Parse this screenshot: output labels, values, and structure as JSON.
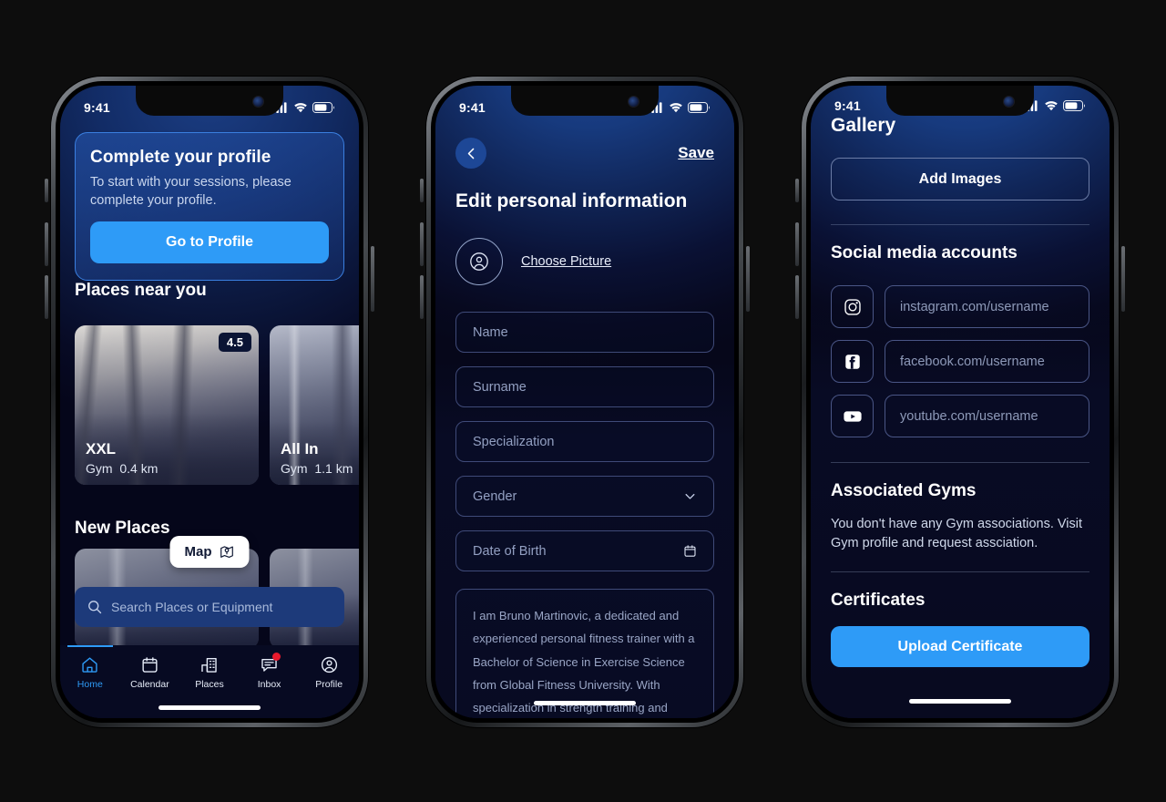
{
  "status_bar": {
    "time": "9:41",
    "cellular": "signal-bars",
    "wifi": "wifi",
    "battery": "battery"
  },
  "phone1": {
    "profile_card": {
      "title": "Complete your profile",
      "body": "To start with your sessions, please complete your profile.",
      "cta": "Go to Profile"
    },
    "places_near_title": "Places near you",
    "places": [
      {
        "rating": "4.5",
        "name": "XXL",
        "type": "Gym",
        "distance": "0.4 km"
      },
      {
        "rating": "",
        "name": "All In",
        "type": "Gym",
        "distance": "1.1 km"
      }
    ],
    "new_places_title": "New Places",
    "map_fab": "Map",
    "search_placeholder": "Search Places or Equipment",
    "tabs": [
      {
        "label": "Home",
        "active": true,
        "badge": false
      },
      {
        "label": "Calendar",
        "active": false,
        "badge": false
      },
      {
        "label": "Places",
        "active": false,
        "badge": false
      },
      {
        "label": "Inbox",
        "active": false,
        "badge": true
      },
      {
        "label": "Profile",
        "active": false,
        "badge": false
      }
    ]
  },
  "phone2": {
    "save_label": "Save",
    "title": "Edit personal information",
    "choose_picture": "Choose Picture",
    "fields": [
      {
        "placeholder": "Name",
        "icon": ""
      },
      {
        "placeholder": "Surname",
        "icon": ""
      },
      {
        "placeholder": "Specialization",
        "icon": ""
      },
      {
        "placeholder": "Gender",
        "icon": "chevron-down-icon"
      },
      {
        "placeholder": "Date of Birth",
        "icon": "calendar-icon"
      }
    ],
    "bio": "I am Bruno Martinovic, a dedicated and experienced personal fitness trainer with a Bachelor of Science in Exercise Science from Global Fitness University. With specialization in strength training and functional fitness, I possess the knowledge and skills to design customized workout programs tailored to each"
  },
  "phone3": {
    "gallery_title": "Gallery",
    "add_images": "Add Images",
    "social_title": "Social media accounts",
    "socials": [
      {
        "icon": "instagram-icon",
        "placeholder": "instagram.com/username"
      },
      {
        "icon": "facebook-icon",
        "placeholder": "facebook.com/username"
      },
      {
        "icon": "youtube-icon",
        "placeholder": "youtube.com/username"
      }
    ],
    "gyms_title": "Associated Gyms",
    "gyms_body": "You don't have any Gym associations. Visit Gym profile and request assciation.",
    "certificates_title": "Certificates",
    "upload_certificate": "Upload Certificate"
  },
  "colors": {
    "accent": "#2e9bf7",
    "badge": "#e8192c",
    "card_border": "#3a7fe0",
    "screen_dark": "#080a20"
  }
}
